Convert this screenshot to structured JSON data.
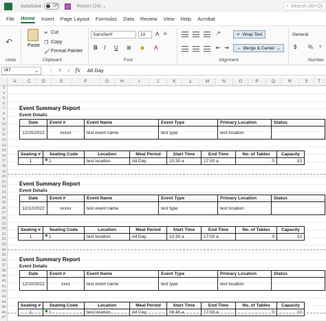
{
  "titlebar": {
    "autosave": "AutoSave",
    "toggle": "Off",
    "doc_title": "Report (24)",
    "search_placeholder": "Search (Alt+Q)"
  },
  "menu": [
    "File",
    "Home",
    "Insert",
    "Page Layout",
    "Formulas",
    "Data",
    "Review",
    "View",
    "Help",
    "Acrobat"
  ],
  "ribbon": {
    "undo_label": "Undo",
    "clipboard": {
      "paste": "Paste",
      "cut": "Cut",
      "copy": "Copy",
      "format_painter": "Format Painter",
      "label": "Clipboard"
    },
    "font": {
      "name": "SansSerif",
      "size": "10",
      "grow": "A",
      "shrink": "A",
      "bold": "B",
      "italic": "I",
      "underline": "U",
      "label": "Font"
    },
    "alignment": {
      "wrap_text": "Wrap Text",
      "merge_center": "Merge & Center",
      "label": "Alignment"
    },
    "number": {
      "format": "General",
      "currency": "$",
      "percent": "%",
      "label": "Number"
    }
  },
  "formula_bar": {
    "cell_ref": "I47",
    "value": "All Day"
  },
  "columns": [
    "A",
    "C",
    "D",
    "E",
    "F",
    "G",
    "H",
    "I",
    "J",
    "K",
    "L",
    "M",
    "N",
    "O",
    "P",
    "Q",
    "R",
    "S",
    "T"
  ],
  "row_numbers": [
    "3",
    "4",
    "5",
    "6",
    "7",
    "8",
    "9",
    "10",
    "11",
    "12",
    "13",
    "14",
    "15",
    "16",
    "17",
    "18",
    "19",
    "20",
    "21",
    "22",
    "23",
    "24",
    "25",
    "26",
    "27",
    "28",
    "29",
    "30",
    "31",
    "32",
    "33",
    "34",
    "35",
    "36",
    "37",
    "38",
    "39",
    "40",
    "41",
    "42",
    "43",
    "44",
    "45",
    "46",
    "47"
  ],
  "event_headers": [
    "Date",
    "Event #",
    "Event Name",
    "Event Type",
    "Primary Location",
    "Status"
  ],
  "seating_headers": [
    "Seating #",
    "Seating Code",
    "Location",
    "Meal Period",
    "Start Time",
    "End Time",
    "No. of Tables",
    "Capacity"
  ],
  "reports": [
    {
      "title": "Event Summary Report",
      "subtitle": "Event Details",
      "event": [
        "12/15/2022",
        "xxxxx",
        "test event name",
        "test type",
        "test location",
        ""
      ],
      "seating": [
        "1",
        "1",
        "test location",
        "All Day",
        "10:30 a",
        "17:00 a",
        "0",
        "10"
      ]
    },
    {
      "title": "Event Summary Report",
      "subtitle": "Event Details",
      "event": [
        "12/12/2022",
        "xxxxx",
        "test event name",
        "test type",
        "test location",
        ""
      ],
      "seating": [
        "1",
        "1",
        "test location",
        "All Day",
        "10:30 a",
        "17:00 a",
        "0",
        "10"
      ]
    },
    {
      "title": "Event Summary Report",
      "subtitle": "Event Details",
      "event": [
        "12/10/2022",
        "xxxx",
        "test event name",
        "test type",
        "test location",
        ""
      ],
      "seating": [
        "1",
        "1",
        "test location",
        "All Day",
        "08:45 a",
        "17:00 a",
        "0",
        "10"
      ]
    }
  ],
  "colors": {
    "accent": "#1f7244"
  }
}
